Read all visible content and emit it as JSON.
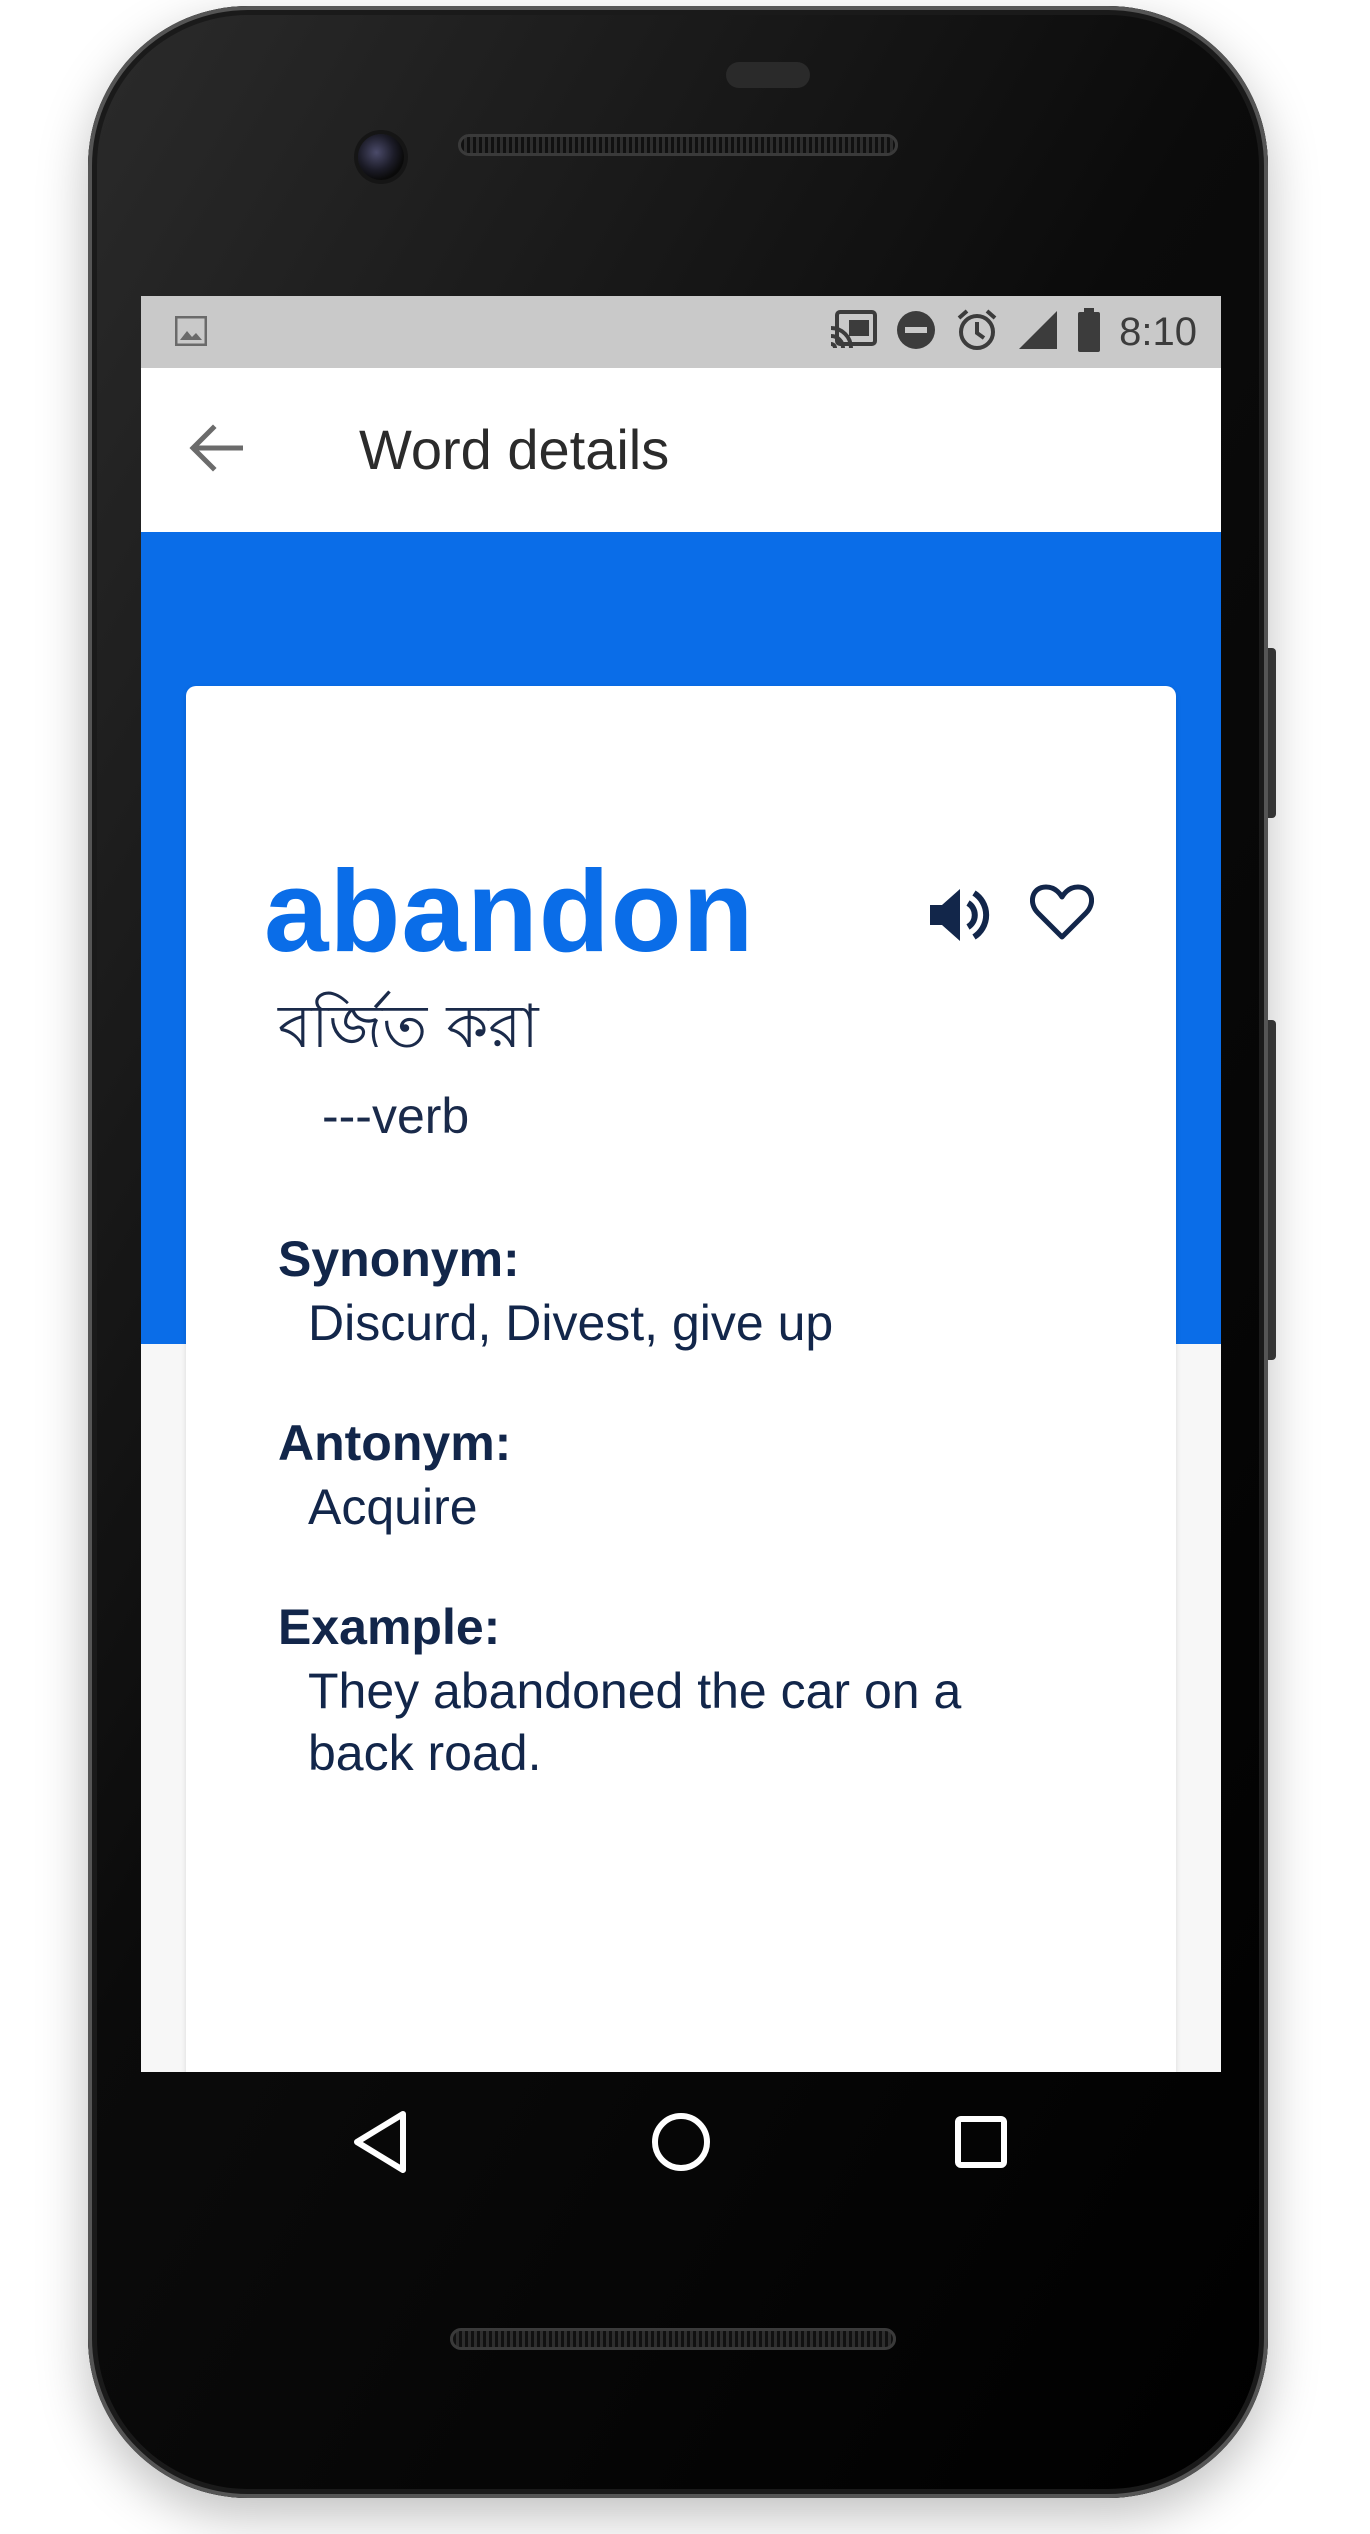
{
  "status_bar": {
    "time": "8:10",
    "icons": [
      "image-icon",
      "cast-icon",
      "do-not-disturb-icon",
      "alarm-icon",
      "signal-icon",
      "battery-icon"
    ]
  },
  "toolbar": {
    "title": "Word details",
    "back_icon": "arrow-back-icon"
  },
  "word_card": {
    "word": "abandon",
    "translation": "বর্জিত করা",
    "part_of_speech": "---verb",
    "synonym_label": "Synonym:",
    "synonym_value": "Discurd, Divest, give up",
    "antonym_label": "Antonym:",
    "antonym_value": "Acquire",
    "example_label": "Example:",
    "example_value": "They abandoned the car on a back road.",
    "actions": [
      "speaker-icon",
      "heart-icon"
    ]
  },
  "nav_bar": {
    "buttons": [
      "back-triangle-icon",
      "home-circle-icon",
      "recents-square-icon"
    ]
  },
  "colors": {
    "accent": "#0a6de8",
    "text_dark": "#12264a",
    "status_bar": "#c9c9c9",
    "toolbar_bg": "#ffffff"
  }
}
